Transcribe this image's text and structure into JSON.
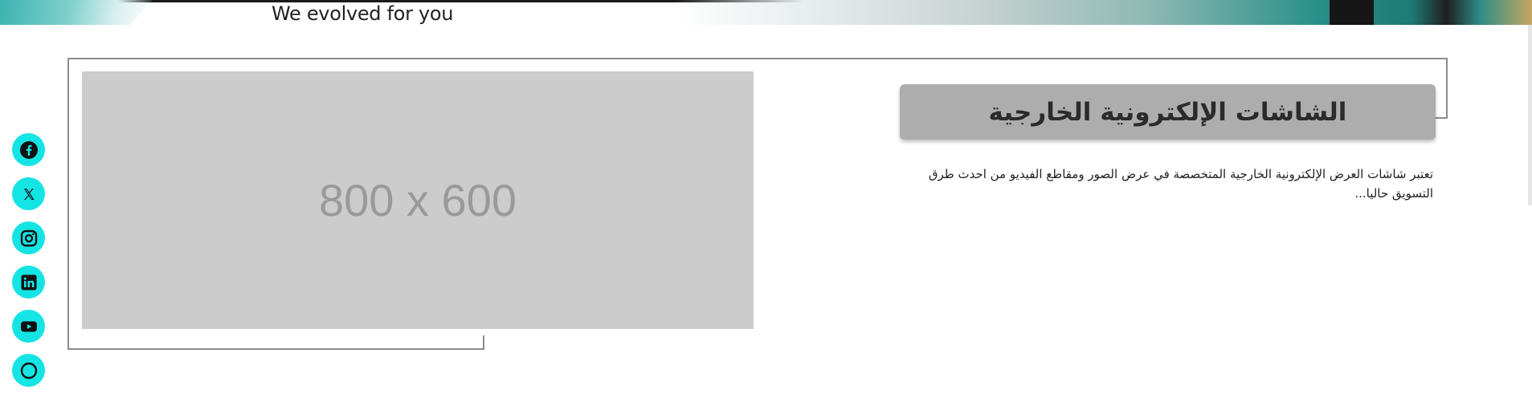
{
  "banner": {
    "tagline": "We evolved for you"
  },
  "social": [
    {
      "name": "facebook",
      "icon": "facebook-icon"
    },
    {
      "name": "x",
      "icon": "x-icon"
    },
    {
      "name": "instagram",
      "icon": "instagram-icon"
    },
    {
      "name": "linkedin",
      "icon": "linkedin-icon"
    },
    {
      "name": "youtube",
      "icon": "youtube-icon"
    },
    {
      "name": "more",
      "icon": "partial-icon"
    }
  ],
  "card": {
    "image_placeholder": "800 x 600",
    "title": "الشاشات الإلكترونية الخارجية",
    "description": "تعتبر شاشات العرض الإلكترونية الخارجية المتخصصة في عرض الصور ومقاطع الفيديو من احدث طرق التسويق حاليا..."
  },
  "colors": {
    "social_bg": "#15e4e4",
    "title_bg": "#adadad",
    "placeholder_bg": "#cccccc",
    "frame": "#8c8c8c"
  }
}
